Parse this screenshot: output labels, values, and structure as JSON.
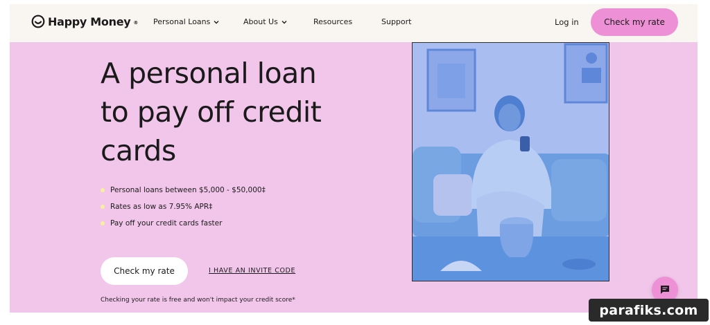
{
  "brand": {
    "name": "Happy Money",
    "registered": "®",
    "accent": "#ee90d6",
    "background": "#f2c6ea",
    "header_bg": "#f9f5f1",
    "bullet_color": "#f6ef9c"
  },
  "nav": {
    "items": [
      {
        "label": "Personal Loans",
        "has_dropdown": true
      },
      {
        "label": "About Us",
        "has_dropdown": true
      },
      {
        "label": "Resources",
        "has_dropdown": false
      },
      {
        "label": "Support",
        "has_dropdown": false
      }
    ],
    "login_label": "Log in",
    "cta_label": "Check my rate"
  },
  "hero": {
    "headline": "A personal loan to pay off credit cards",
    "bullets": [
      "Personal loans between $5,000 - $50,000‡",
      "Rates as low as 7.95% APR‡",
      "Pay off your credit cards faster"
    ],
    "cta_label": "Check my rate",
    "invite_label": "I HAVE AN INVITE CODE",
    "disclaimer": "Checking your rate is free and won't impact your credit score*"
  },
  "chat": {
    "icon": "chat-icon"
  },
  "watermark": {
    "text": "parafiks.com"
  }
}
